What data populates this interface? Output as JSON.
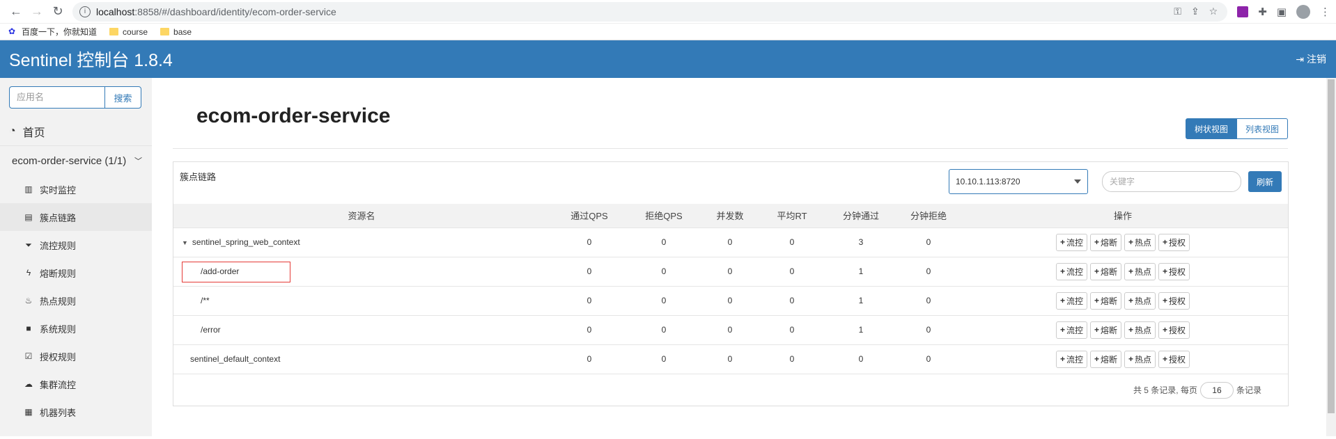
{
  "browser": {
    "url_host": "localhost",
    "url_rest": ":8858/#/dashboard/identity/ecom-order-service",
    "bookmarks": [
      {
        "label": "百度一下，你就知道",
        "icon": "baidu-paw-icon"
      },
      {
        "label": "course",
        "icon": "folder-icon"
      },
      {
        "label": "base",
        "icon": "folder-icon"
      }
    ]
  },
  "header": {
    "title": "Sentinel 控制台 1.8.4",
    "logout_label": "注销"
  },
  "sidebar": {
    "search_placeholder": "应用名",
    "search_button": "搜索",
    "home_label": "首页",
    "app_label": "ecom-order-service (1/1)",
    "items": [
      {
        "label": "实时监控",
        "icon": "bar-chart-icon"
      },
      {
        "label": "簇点链路",
        "icon": "list-icon",
        "active": true
      },
      {
        "label": "流控规则",
        "icon": "filter-icon"
      },
      {
        "label": "熔断规则",
        "icon": "flash-icon"
      },
      {
        "label": "热点规则",
        "icon": "fire-icon"
      },
      {
        "label": "系统规则",
        "icon": "lock-icon"
      },
      {
        "label": "授权规则",
        "icon": "check-square-icon"
      },
      {
        "label": "集群流控",
        "icon": "cloud-icon"
      },
      {
        "label": "机器列表",
        "icon": "grid-icon"
      }
    ]
  },
  "page": {
    "title": "ecom-order-service",
    "view_tree": "树状视图",
    "view_list": "列表视图"
  },
  "panel": {
    "label": "簇点链路",
    "machine": "10.10.1.113:8720",
    "keyword_placeholder": "关键字",
    "refresh": "刷新"
  },
  "table": {
    "headers": [
      "资源名",
      "通过QPS",
      "拒绝QPS",
      "并发数",
      "平均RT",
      "分钟通过",
      "分钟拒绝",
      "操作"
    ],
    "rows": [
      {
        "name": "sentinel_spring_web_context",
        "pass_qps": "0",
        "block_qps": "0",
        "threads": "0",
        "avg_rt": "0",
        "min_pass": "3",
        "min_block": "0"
      },
      {
        "name": "/add-order",
        "pass_qps": "0",
        "block_qps": "0",
        "threads": "0",
        "avg_rt": "0",
        "min_pass": "1",
        "min_block": "0"
      },
      {
        "name": "/**",
        "pass_qps": "0",
        "block_qps": "0",
        "threads": "0",
        "avg_rt": "0",
        "min_pass": "1",
        "min_block": "0"
      },
      {
        "name": "/error",
        "pass_qps": "0",
        "block_qps": "0",
        "threads": "0",
        "avg_rt": "0",
        "min_pass": "1",
        "min_block": "0"
      },
      {
        "name": "sentinel_default_context",
        "pass_qps": "0",
        "block_qps": "0",
        "threads": "0",
        "avg_rt": "0",
        "min_pass": "0",
        "min_block": "0"
      }
    ],
    "ops": [
      "流控",
      "熔断",
      "热点",
      "授权"
    ]
  },
  "pager": {
    "summary": "共 5 条记录, 每页",
    "page_size": "16",
    "suffix": "条记录"
  }
}
